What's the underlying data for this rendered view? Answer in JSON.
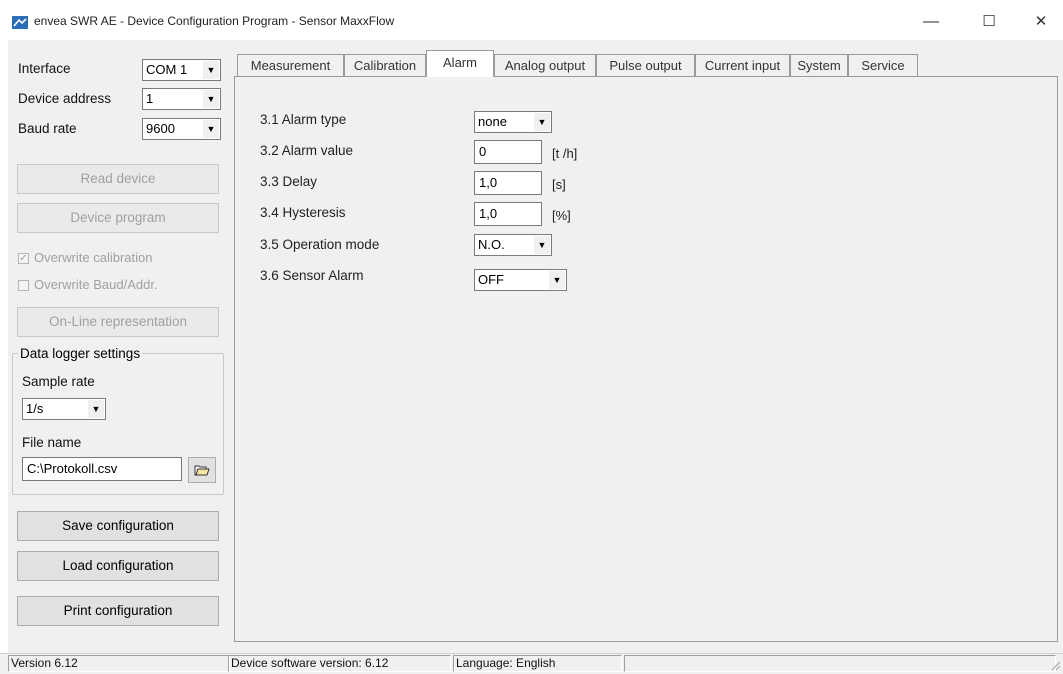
{
  "window": {
    "title": "envea SWR AE - Device Configuration Program - Sensor MaxxFlow",
    "minimize": "—",
    "maximize": "☐",
    "close": "✕"
  },
  "left": {
    "interface_label": "Interface",
    "interface_value": "COM 1",
    "address_label": "Device address",
    "address_value": "1",
    "baud_label": "Baud rate",
    "baud_value": "9600",
    "read_device": "Read device",
    "device_program": "Device program",
    "overwrite_calibration": "Overwrite calibration",
    "overwrite_calibration_checked": true,
    "overwrite_baud": "Overwrite Baud/Addr.",
    "overwrite_baud_checked": false,
    "online": "On-Line representation",
    "logger_title": "Data logger settings",
    "sample_rate_label": "Sample rate",
    "sample_rate_value": "1/s",
    "file_name_label": "File name",
    "file_name_value": "C:\\Protokoll.csv",
    "save_config": "Save configuration",
    "load_config": "Load configuration",
    "print_config": "Print configuration"
  },
  "tabs": [
    "Measurement",
    "Calibration",
    "Alarm",
    "Analog output",
    "Pulse output",
    "Current input",
    "System",
    "Service"
  ],
  "active_tab": "Alarm",
  "alarm": {
    "rows": [
      {
        "label": "3.1 Alarm type",
        "value": "none",
        "unit": ""
      },
      {
        "label": "3.2 Alarm value",
        "value": "0",
        "unit": "[t /h]"
      },
      {
        "label": "3.3 Delay",
        "value": "1,0",
        "unit": "[s]"
      },
      {
        "label": "3.4 Hysteresis",
        "value": "1,0",
        "unit": "[%]"
      },
      {
        "label": "3.5 Operation mode",
        "value": "N.O.",
        "unit": ""
      },
      {
        "label": "3.6 Sensor Alarm",
        "value": "OFF",
        "unit": ""
      }
    ]
  },
  "status": {
    "version": "Version 6.12",
    "device_sw": "Device software version: 6.12",
    "language": "Language: English"
  },
  "colors": {
    "window_bg": "#f0f0f0",
    "title_bg": "#ffffff",
    "icon_blue": "#2a6fb5"
  }
}
